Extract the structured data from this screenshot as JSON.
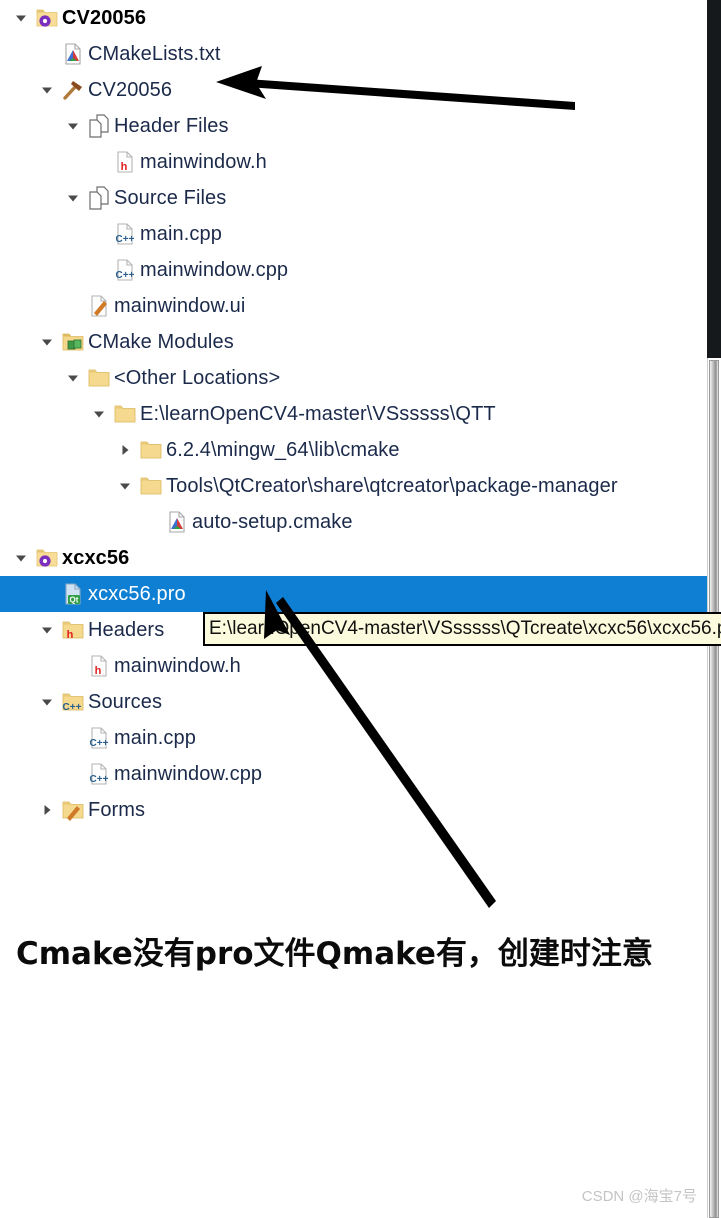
{
  "window": {
    "kind": "qt-creator-project-tree",
    "selection_color": "#0f7fd4",
    "label_color": "#1b2a4a",
    "tooltip_bg": "#fdfbdd"
  },
  "tree": {
    "rows": [
      {
        "indent": 0,
        "twisty": "down",
        "icon": "project-folder-gear-icon",
        "label": "CV20056",
        "bold": true,
        "selected": false
      },
      {
        "indent": 1,
        "twisty": "none",
        "icon": "cmake-file-icon",
        "label": "CMakeLists.txt",
        "bold": false,
        "selected": false
      },
      {
        "indent": 1,
        "twisty": "down",
        "icon": "hammer-build-icon",
        "label": "CV20056",
        "bold": false,
        "selected": false
      },
      {
        "indent": 2,
        "twisty": "down",
        "icon": "file-group-icon",
        "label": "Header Files",
        "bold": false,
        "selected": false
      },
      {
        "indent": 3,
        "twisty": "none",
        "icon": "header-file-icon",
        "label": "mainwindow.h",
        "bold": false,
        "selected": false
      },
      {
        "indent": 2,
        "twisty": "down",
        "icon": "file-group-icon",
        "label": "Source Files",
        "bold": false,
        "selected": false
      },
      {
        "indent": 3,
        "twisty": "none",
        "icon": "cpp-file-icon",
        "label": "main.cpp",
        "bold": false,
        "selected": false
      },
      {
        "indent": 3,
        "twisty": "none",
        "icon": "cpp-file-icon",
        "label": "mainwindow.cpp",
        "bold": false,
        "selected": false
      },
      {
        "indent": 2,
        "twisty": "none",
        "icon": "ui-form-file-icon",
        "label": "mainwindow.ui",
        "bold": false,
        "selected": false
      },
      {
        "indent": 1,
        "twisty": "down",
        "icon": "cmake-modules-icon",
        "label": "CMake Modules",
        "bold": false,
        "selected": false
      },
      {
        "indent": 2,
        "twisty": "down",
        "icon": "folder-icon",
        "label": "<Other Locations>",
        "bold": false,
        "selected": false
      },
      {
        "indent": 3,
        "twisty": "down",
        "icon": "folder-icon",
        "label": "E:\\learnOpenCV4-master\\VSsssss\\QTT",
        "bold": false,
        "selected": false
      },
      {
        "indent": 4,
        "twisty": "right",
        "icon": "folder-icon",
        "label": "6.2.4\\mingw_64\\lib\\cmake",
        "bold": false,
        "selected": false
      },
      {
        "indent": 4,
        "twisty": "down",
        "icon": "folder-icon",
        "label": "Tools\\QtCreator\\share\\qtcreator\\package-manager",
        "bold": false,
        "selected": false
      },
      {
        "indent": 5,
        "twisty": "none",
        "icon": "cmake-file-icon",
        "label": "auto-setup.cmake",
        "bold": false,
        "selected": false
      },
      {
        "indent": 0,
        "twisty": "down",
        "icon": "project-folder-gear-icon",
        "label": "xcxc56",
        "bold": true,
        "selected": false
      },
      {
        "indent": 1,
        "twisty": "none",
        "icon": "qt-pro-file-icon",
        "label": "xcxc56.pro",
        "bold": false,
        "selected": true
      },
      {
        "indent": 1,
        "twisty": "down",
        "icon": "headers-folder-icon",
        "label": "Headers",
        "bold": false,
        "selected": false
      },
      {
        "indent": 2,
        "twisty": "none",
        "icon": "header-file-icon",
        "label": "mainwindow.h",
        "bold": false,
        "selected": false
      },
      {
        "indent": 1,
        "twisty": "down",
        "icon": "sources-folder-icon",
        "label": "Sources",
        "bold": false,
        "selected": false
      },
      {
        "indent": 2,
        "twisty": "none",
        "icon": "cpp-file-icon",
        "label": "main.cpp",
        "bold": false,
        "selected": false
      },
      {
        "indent": 2,
        "twisty": "none",
        "icon": "cpp-file-icon",
        "label": "mainwindow.cpp",
        "bold": false,
        "selected": false
      },
      {
        "indent": 1,
        "twisty": "right",
        "icon": "forms-folder-icon",
        "label": "Forms",
        "bold": false,
        "selected": false
      }
    ]
  },
  "tooltip": {
    "text": "E:\\learnOpenCV4-master\\VSsssss\\QTcreate\\xcxc56\\xcxc56.p"
  },
  "annotations": {
    "caption": "Cmake没有pro文件Qmake有，创建时注意",
    "arrow_top": "arrow-pointing-to-cv20056-build-target",
    "arrow_bottom": "arrow-pointing-to-xcxc56-pro"
  },
  "watermark": {
    "text": "CSDN @海宝7号"
  }
}
